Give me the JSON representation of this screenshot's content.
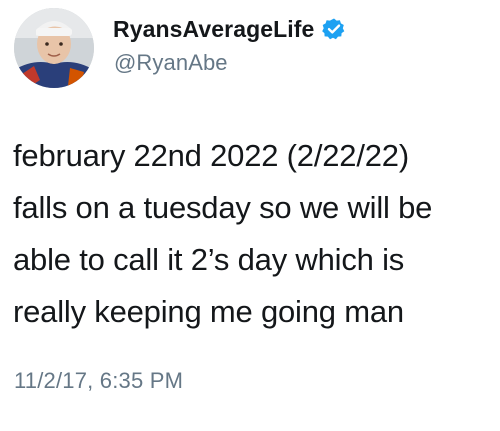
{
  "tweet": {
    "author": {
      "display_name": "RyansAverageLife",
      "handle": "@RyanAbe",
      "verified": true,
      "verified_icon": "verified-badge-icon",
      "avatar_icon": "user-avatar"
    },
    "body_lines": [
      "february 22nd 2022 (2/22/22)",
      "falls on a tuesday so we will be",
      "able to call it 2’s day which is",
      "really keeping me going man"
    ],
    "timestamp": "11/2/17, 6:35 PM"
  },
  "colors": {
    "text_primary": "#14171a",
    "text_secondary": "#657786",
    "verified_blue": "#1da1f2",
    "background": "#ffffff"
  }
}
